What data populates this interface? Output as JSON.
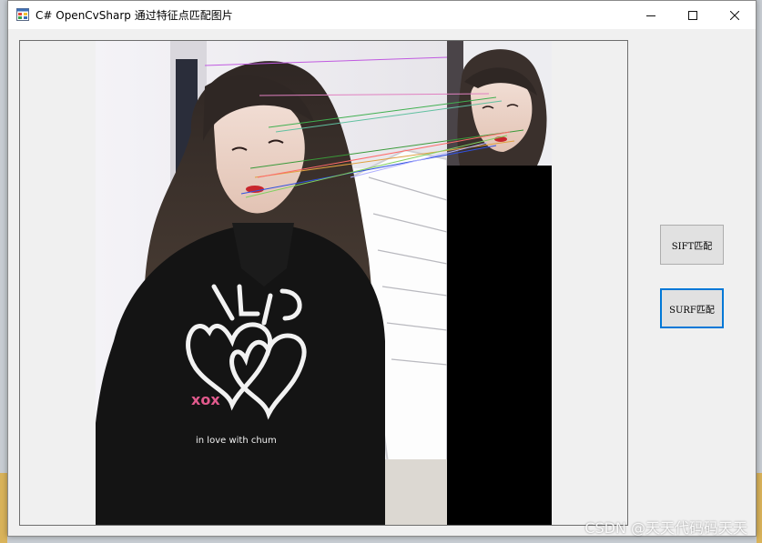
{
  "window": {
    "title": "C# OpenCvSharp 通过特征点匹配图片",
    "icons": {
      "app": "winforms-app-icon",
      "minimize": "minimize-icon",
      "maximize": "maximize-icon",
      "close": "close-icon"
    }
  },
  "buttons": {
    "sift_label": "SIFT匹配",
    "surf_label": "SURF匹配"
  },
  "image": {
    "description_name": "feature-match-result",
    "colors": {
      "background_wall": "#f3f2f6",
      "hair": "#3a302c",
      "sweater": "#151515",
      "black_fill": "#000000",
      "skin": "#ead3c6"
    }
  },
  "watermark": "CSDN @天天代码码天天"
}
